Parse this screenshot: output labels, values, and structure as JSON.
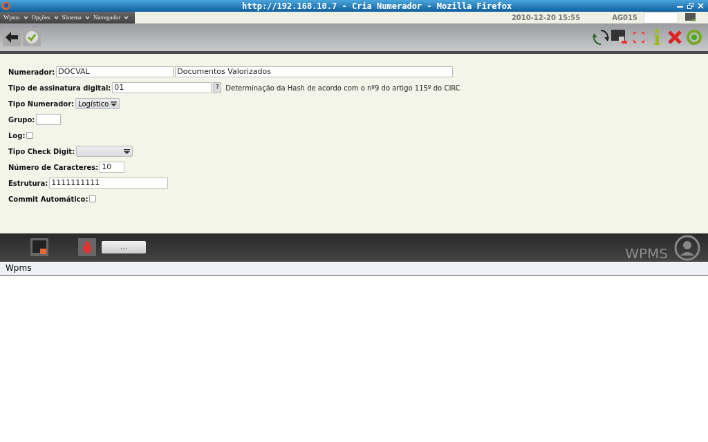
{
  "window": {
    "title": "http://192.168.10.7 - Cria Numerador - Mozilla Firefox"
  },
  "menu": [
    "Wpms",
    "Opções",
    "Sistema",
    "Navegador"
  ],
  "header": {
    "datetime": "2010-12-20 15:55",
    "user": "AG015"
  },
  "form": [
    {
      "kind": "text2",
      "label": "Numerador:",
      "value": "DOCVAL",
      "value2": "Documentos Valorizados"
    },
    {
      "kind": "lookup",
      "label": "Tipo de assinatura digital:",
      "value": "01",
      "button": "?",
      "description": "Determinação da Hash de acordo com o nº9 do artigo 115º do CIRC"
    },
    {
      "kind": "select",
      "label": "Tipo Numerador:",
      "value": "Logístico"
    },
    {
      "kind": "text",
      "label": "Grupo:"
    },
    {
      "kind": "checkbox",
      "label": "Log:",
      "checked": false
    },
    {
      "kind": "select",
      "label": "Tipo Check Digit:"
    },
    {
      "kind": "text",
      "label": "Número de Caracteres:",
      "value": "10"
    },
    {
      "kind": "text",
      "label": "Estrutura:",
      "value": "1111111111"
    },
    {
      "kind": "checkbox",
      "label": "Commit Automático:",
      "checked": false
    }
  ],
  "footer": {
    "button": "...",
    "logo": "WPMS"
  },
  "status_bar": "Wpms"
}
